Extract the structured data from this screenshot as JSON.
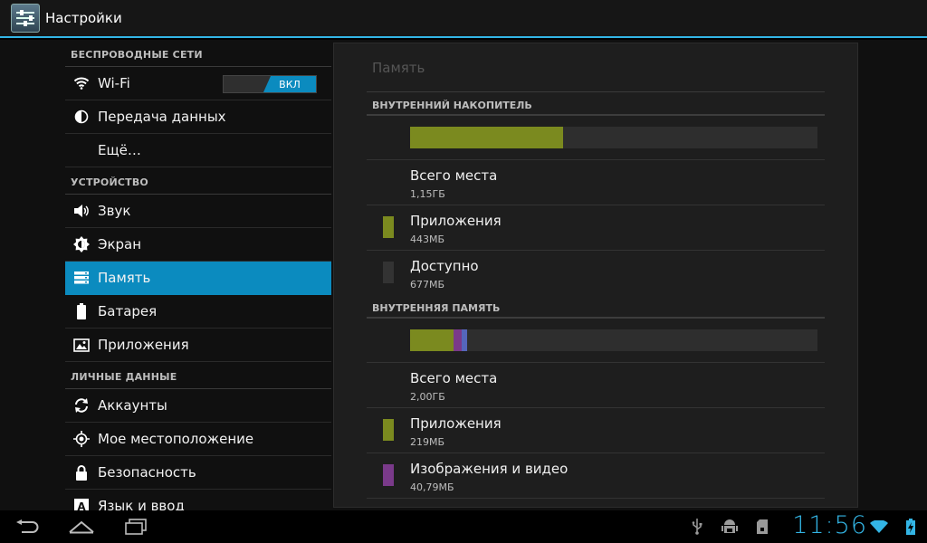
{
  "actionbar": {
    "title": "Настройки",
    "icon": "settings-app-icon"
  },
  "sidebar": {
    "groups": [
      {
        "header": "БЕСПРОВОДНЫЕ СЕТИ",
        "items": [
          {
            "label": "Wi-Fi",
            "icon": "wifi-icon",
            "toggle": "ВКЛ"
          },
          {
            "label": "Передача данных",
            "icon": "data-usage-icon"
          },
          {
            "label": "Ещё…",
            "icon": ""
          }
        ]
      },
      {
        "header": "УСТРОЙСТВО",
        "items": [
          {
            "label": "Звук",
            "icon": "speaker-icon"
          },
          {
            "label": "Экран",
            "icon": "brightness-icon"
          },
          {
            "label": "Память",
            "icon": "storage-icon",
            "selected": true
          },
          {
            "label": "Батарея",
            "icon": "battery-icon"
          },
          {
            "label": "Приложения",
            "icon": "apps-icon"
          }
        ]
      },
      {
        "header": "ЛИЧНЫЕ ДАННЫЕ",
        "items": [
          {
            "label": "Аккаунты",
            "icon": "sync-icon"
          },
          {
            "label": "Мое местоположение",
            "icon": "location-icon"
          },
          {
            "label": "Безопасность",
            "icon": "lock-icon"
          },
          {
            "label": "Язык и ввод",
            "icon": "keyboard-a-icon"
          }
        ]
      }
    ]
  },
  "panel": {
    "title": "Память",
    "sections": [
      {
        "header": "ВНУТРЕННИЙ НАКОПИТЕЛЬ",
        "bar": [
          {
            "fraction": 0.376,
            "color": "#7b8a1f"
          }
        ],
        "rows": [
          {
            "title": "Всего места",
            "value": "1,15ГБ"
          },
          {
            "title": "Приложения",
            "value": "443МБ",
            "color": "#7b8a1f"
          },
          {
            "title": "Доступно",
            "value": "677МБ",
            "color": "#333333"
          }
        ]
      },
      {
        "header": "ВНУТРЕННЯЯ ПАМЯТЬ",
        "bar": [
          {
            "fraction": 0.107,
            "color": "#7b8a1f"
          },
          {
            "fraction": 0.02,
            "color": "#7a3a8a"
          },
          {
            "fraction": 0.012,
            "color": "#5566bb"
          }
        ],
        "rows": [
          {
            "title": "Всего места",
            "value": "2,00ГБ"
          },
          {
            "title": "Приложения",
            "value": "219МБ",
            "color": "#7b8a1f"
          },
          {
            "title": "Изображения и видео",
            "value": "40,79МБ",
            "color": "#7a3a8a"
          }
        ]
      }
    ]
  },
  "statusbar": {
    "clock": "11:56",
    "icons": [
      "usb-icon",
      "android-debug-icon",
      "sd-card-icon",
      "wifi-signal-icon",
      "battery-charging-icon"
    ],
    "accent": "#33b5e5"
  },
  "navbar": {
    "buttons": [
      "back-icon",
      "home-icon",
      "recent-apps-icon"
    ]
  }
}
